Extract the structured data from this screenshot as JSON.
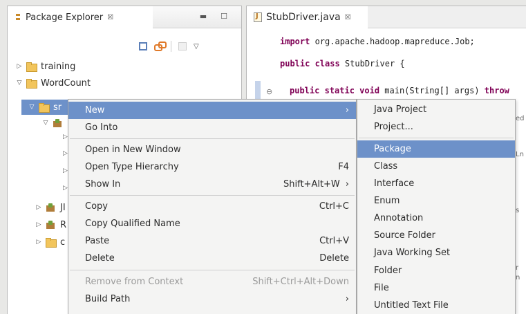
{
  "package_explorer": {
    "title": "Package Explorer",
    "close_glyph": "☒",
    "minimize_glyph": "▬",
    "maximize_glyph": "☐",
    "menu_glyph": "▽",
    "tree": [
      {
        "label": "training",
        "expanded": false
      },
      {
        "label": "WordCount",
        "expanded": true
      },
      {
        "label": "sr",
        "expanded": true
      },
      {
        "label": "JI"
      },
      {
        "label": "R"
      },
      {
        "label": "c"
      }
    ]
  },
  "editor": {
    "tab_title": "StubDriver.java",
    "close_glyph": "☒",
    "code": {
      "line1_kw": "import",
      "line1_rest": " org.apache.hadoop.mapreduce.Job;",
      "line2_kw": "public class",
      "line2_rest": " StubDriver {",
      "line3_kw1": "public static void",
      "line3_rest": " main(String[] args) ",
      "line3_kw2": "throw"
    },
    "fold_glyph": "⊖",
    "edge_fragments": [
      "ed",
      "Ln",
      "s",
      "r",
      "n"
    ]
  },
  "context_menu": {
    "items": [
      {
        "label": "New",
        "accel": "",
        "submenu": true,
        "active": true
      },
      {
        "label": "Go Into",
        "accel": ""
      },
      {
        "sep": true
      },
      {
        "label": "Open in New Window",
        "accel": ""
      },
      {
        "label": "Open Type Hierarchy",
        "accel": "F4"
      },
      {
        "label": "Show In",
        "accel": "Shift+Alt+W",
        "submenu": true
      },
      {
        "sep": true
      },
      {
        "label": "Copy",
        "accel": "Ctrl+C"
      },
      {
        "label": "Copy Qualified Name",
        "accel": ""
      },
      {
        "label": "Paste",
        "accel": "Ctrl+V"
      },
      {
        "label": "Delete",
        "accel": "Delete"
      },
      {
        "sep": true
      },
      {
        "label": "Remove from Context",
        "accel": "Shift+Ctrl+Alt+Down",
        "disabled": true
      },
      {
        "label": "Build Path",
        "accel": "",
        "submenu": true
      }
    ]
  },
  "new_submenu": {
    "items": [
      {
        "label": "Java Project"
      },
      {
        "label": "Project..."
      },
      {
        "sep": true
      },
      {
        "label": "Package",
        "active": true
      },
      {
        "label": "Class"
      },
      {
        "label": "Interface"
      },
      {
        "label": "Enum"
      },
      {
        "label": "Annotation"
      },
      {
        "label": "Source Folder"
      },
      {
        "label": "Java Working Set"
      },
      {
        "label": "Folder"
      },
      {
        "label": "File"
      },
      {
        "label": "Untitled Text File"
      }
    ]
  },
  "colors": {
    "selection": "#6d91c9",
    "keyword": "#7f0055"
  },
  "glyphs": {
    "submenu_arrow": "›",
    "expanded": "▽",
    "collapsed": "▷"
  }
}
